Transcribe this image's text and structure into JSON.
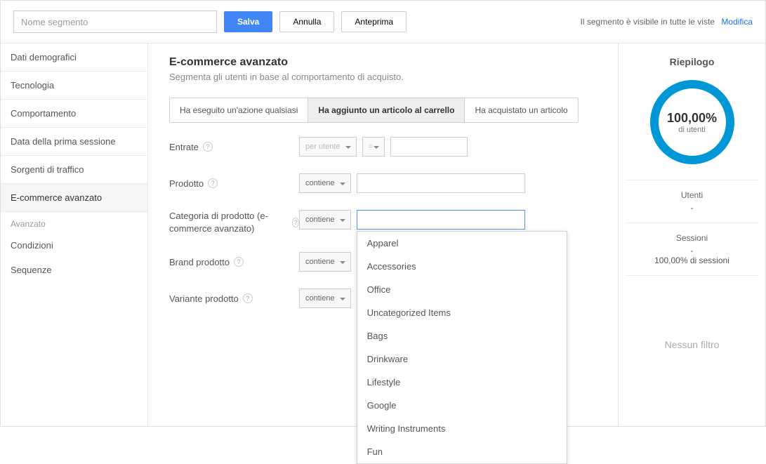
{
  "toolbar": {
    "name_placeholder": "Nome segmento",
    "save": "Salva",
    "cancel": "Annulla",
    "preview": "Anteprima",
    "visibility_text": "Il segmento è visibile in tutte le viste",
    "edit_link": "Modifica"
  },
  "sidebar": {
    "items": [
      "Dati demografici",
      "Tecnologia",
      "Comportamento",
      "Data della prima sessione",
      "Sorgenti di traffico",
      "E-commerce avanzato"
    ],
    "advanced_label": "Avanzato",
    "advanced_items": [
      "Condizioni",
      "Sequenze"
    ]
  },
  "main": {
    "title": "E-commerce avanzato",
    "desc": "Segmenta gli utenti in base al comportamento di acquisto.",
    "action_tabs": [
      "Ha eseguito un'azione qualsiasi",
      "Ha aggiunto un articolo al carrello",
      "Ha acquistato un articolo"
    ],
    "rows": {
      "revenue": {
        "label": "Entrate",
        "per": "per utente",
        "op": "="
      },
      "product": {
        "label": "Prodotto",
        "op": "contiene"
      },
      "category": {
        "label": "Categoria di prodotto (e-commerce avanzato)",
        "op": "contiene"
      },
      "brand": {
        "label": "Brand prodotto",
        "op": "contiene"
      },
      "variant": {
        "label": "Variante prodotto",
        "op": "contiene"
      }
    },
    "dropdown_options": [
      "Apparel",
      "Accessories",
      "Office",
      "Uncategorized Items",
      "Bags",
      "Drinkware",
      "Lifestyle",
      "Google",
      "Writing Instruments",
      "Fun"
    ]
  },
  "summary": {
    "title": "Riepilogo",
    "pct": "100,00%",
    "pct_label": "di utenti",
    "users_label": "Utenti",
    "users_value": "-",
    "sessions_label": "Sessioni",
    "sessions_value": "-",
    "sessions_pct": "100,00% di sessioni",
    "no_filter": "Nessun filtro"
  }
}
